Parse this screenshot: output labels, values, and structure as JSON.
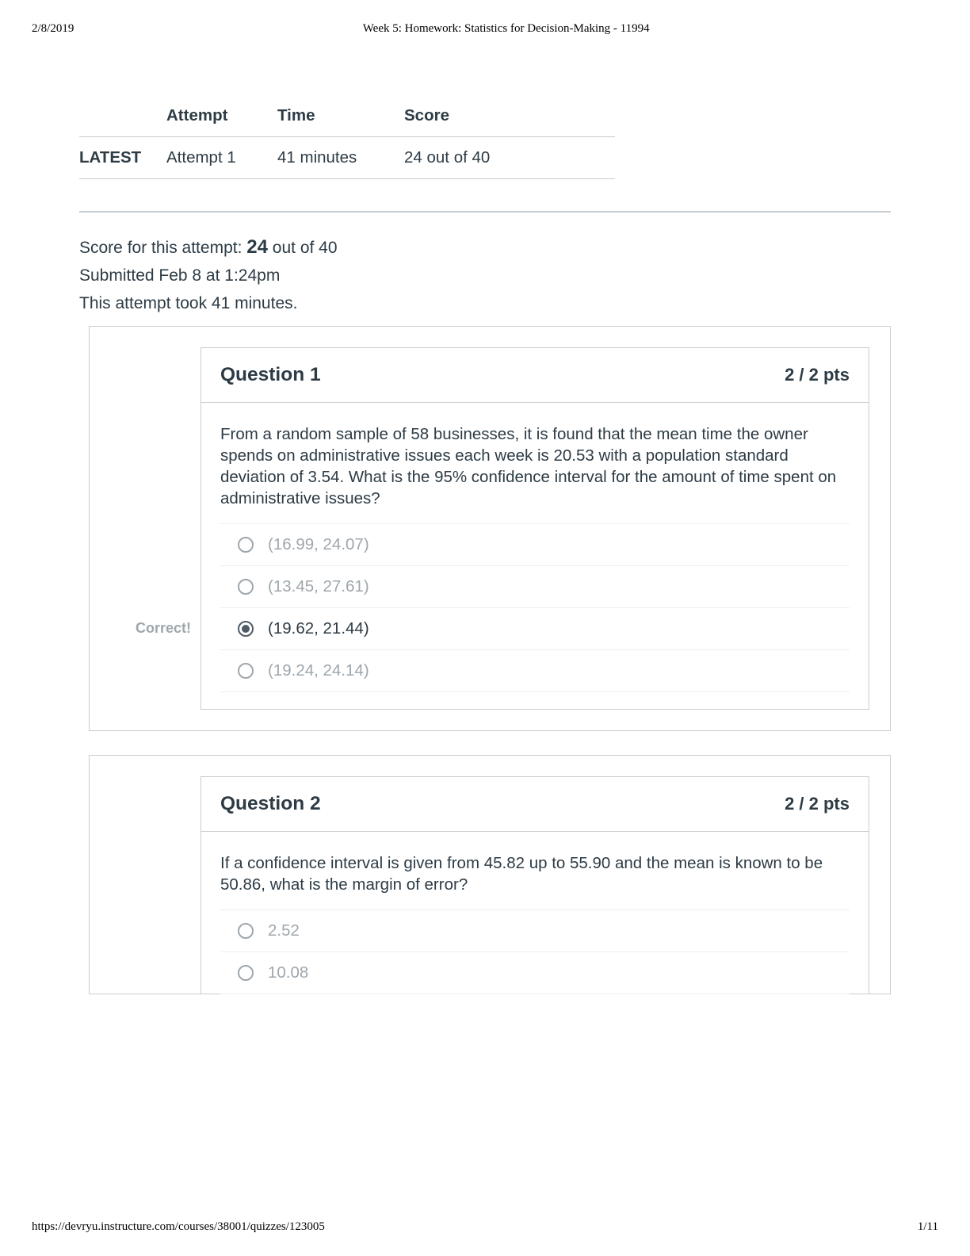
{
  "print": {
    "date": "2/8/2019",
    "title": "Week 5: Homework: Statistics for Decision-Making - 11994",
    "url": "https://devryu.instructure.com/courses/38001/quizzes/123005",
    "page": "1/11"
  },
  "attempt_table": {
    "headers": [
      "",
      "Attempt",
      "Time",
      "Score"
    ],
    "row": {
      "latest": "LATEST",
      "attempt": "Attempt 1",
      "time": "41 minutes",
      "score": "24 out of 40"
    }
  },
  "summary": {
    "score_prefix": "Score for this attempt: ",
    "score_value": "24",
    "score_suffix": " out of 40",
    "submitted": "Submitted Feb 8 at 1:24pm",
    "duration": "This attempt took 41 minutes."
  },
  "questions": [
    {
      "title": "Question 1",
      "pts": "2 / 2 pts",
      "text": "From a random sample of 58 businesses, it is found that the mean time the owner spends on administrative issues each week is 20.53 with a population standard deviation of 3.54. What is the 95% confidence interval for the amount of time spent on administrative issues?",
      "gutter_label": "Correct!",
      "answers": [
        {
          "text": "(16.99, 24.07)",
          "selected": false
        },
        {
          "text": "(13.45, 27.61)",
          "selected": false
        },
        {
          "text": "(19.62, 21.44)",
          "selected": true
        },
        {
          "text": "(19.24, 24.14)",
          "selected": false
        }
      ]
    },
    {
      "title": "Question 2",
      "pts": "2 / 2 pts",
      "text": "If a confidence interval is given from 45.82 up to 55.90 and the mean is known to be 50.86, what is the margin of error?",
      "gutter_label": "",
      "answers": [
        {
          "text": "2.52",
          "selected": false
        },
        {
          "text": "10.08",
          "selected": false
        }
      ]
    }
  ]
}
